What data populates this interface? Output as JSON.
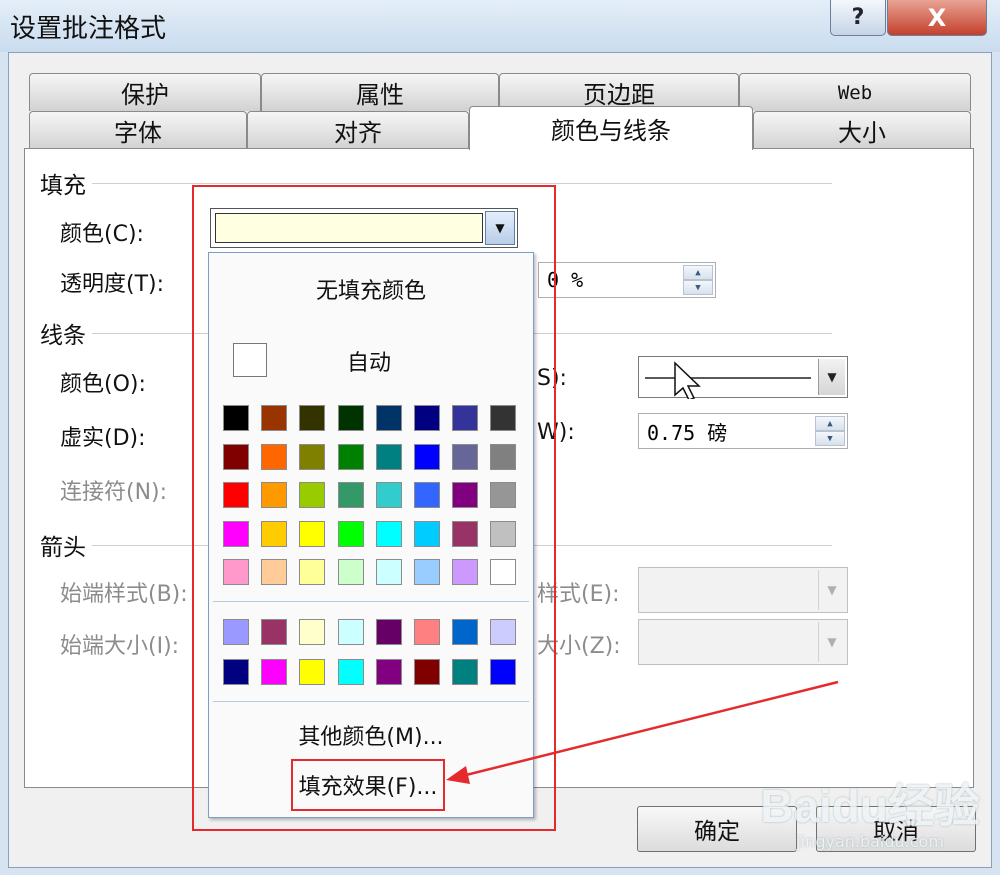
{
  "window": {
    "title": "设置批注格式",
    "help_symbol": "?",
    "close_symbol": "X"
  },
  "tabs_back": [
    {
      "label": "保护"
    },
    {
      "label": "属性"
    },
    {
      "label": "页边距"
    },
    {
      "label": "Web"
    }
  ],
  "tabs_front": [
    {
      "label": "字体"
    },
    {
      "label": "对齐"
    },
    {
      "label": "颜色与线条",
      "active": true
    },
    {
      "label": "大小"
    }
  ],
  "fill": {
    "section": "填充",
    "color_label": "颜色(C):",
    "color_value": "#ffffe1",
    "transparency_label": "透明度(T):",
    "transparency_value": "0 %"
  },
  "lines": {
    "section": "线条",
    "color_label": "颜色(O):",
    "dash_label": "虚实(D):",
    "connector_label": "连接符(N):",
    "style_label_partial": "S):",
    "weight_label_partial": "W):",
    "weight_value": "0.75 磅"
  },
  "arrows": {
    "section": "箭头",
    "begin_style_label": "始端样式(B):",
    "begin_size_label": "始端大小(I):",
    "end_style_label_partial": "样式(E):",
    "end_size_label_partial": "大小(Z):"
  },
  "color_dropdown": {
    "no_fill": "无填充颜色",
    "auto": "自动",
    "standard_colors": [
      "#000000",
      "#993300",
      "#333300",
      "#003300",
      "#003366",
      "#000080",
      "#333399",
      "#333333",
      "#800000",
      "#ff6600",
      "#808000",
      "#008000",
      "#008080",
      "#0000ff",
      "#666699",
      "#808080",
      "#ff0000",
      "#ff9900",
      "#99cc00",
      "#339966",
      "#33cccc",
      "#3366ff",
      "#800080",
      "#969696",
      "#ff00ff",
      "#ffcc00",
      "#ffff00",
      "#00ff00",
      "#00ffff",
      "#00ccff",
      "#993366",
      "#c0c0c0",
      "#ff99cc",
      "#ffcc99",
      "#ffff99",
      "#ccffcc",
      "#ccffff",
      "#99ccff",
      "#cc99ff",
      "#ffffff"
    ],
    "chart_colors": [
      "#9999ff",
      "#993366",
      "#ffffcc",
      "#ccffff",
      "#660066",
      "#ff8080",
      "#0066cc",
      "#ccccff",
      "#000080",
      "#ff00ff",
      "#ffff00",
      "#00ffff",
      "#800080",
      "#800000",
      "#008080",
      "#0000ff"
    ],
    "more_colors": "其他颜色(M)...",
    "fill_effects": "填充效果(F)..."
  },
  "buttons": {
    "ok": "确定",
    "cancel": "取消"
  },
  "watermark": {
    "main": "Baidu经验",
    "sub": "jingyan.baidu.com"
  }
}
